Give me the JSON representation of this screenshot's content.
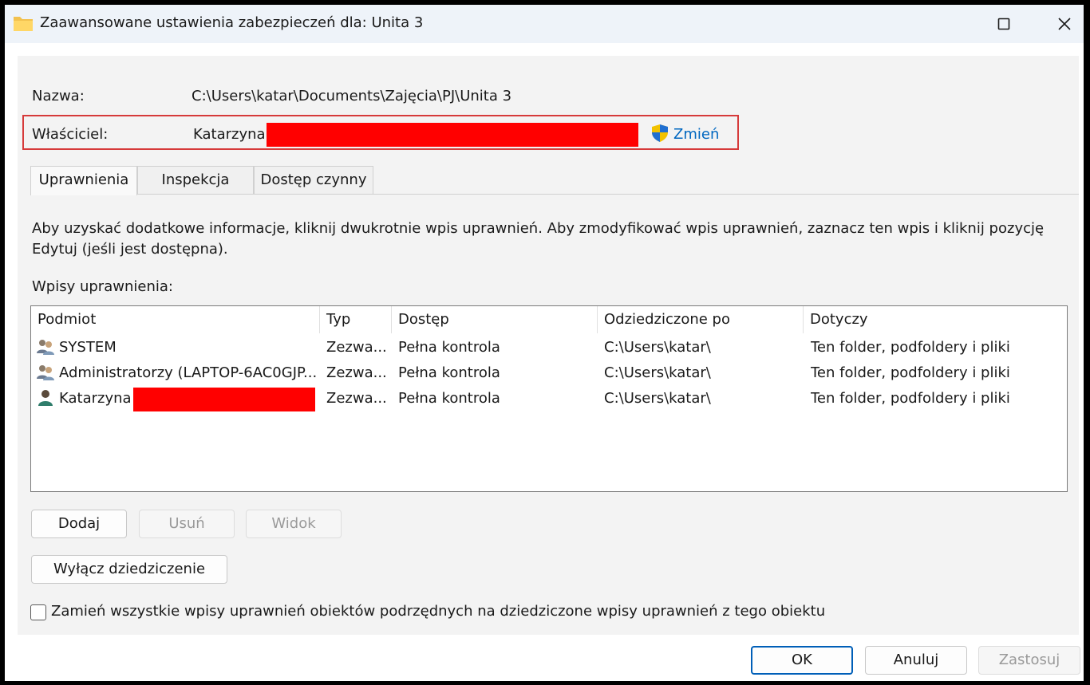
{
  "window": {
    "title": "Zaawansowane ustawienia zabezpieczeń dla: Unita 3",
    "maximize_glyph": "☐",
    "close_glyph": "✕"
  },
  "name": {
    "label": "Nazwa:",
    "value": "C:\\Users\\katar\\Documents\\Zajęcia\\PJ\\Unita 3"
  },
  "owner": {
    "label": "Właściciel:",
    "value": "Katarzyna",
    "change_label": "Zmień"
  },
  "tabs": [
    {
      "label": "Uprawnienia"
    },
    {
      "label": "Inspekcja"
    },
    {
      "label": "Dostęp czynny"
    }
  ],
  "info_text_line1": "Aby uzyskać dodatkowe informacje, kliknij dwukrotnie wpis uprawnień. Aby zmodyfikować wpis uprawnień, zaznacz ten wpis i kliknij pozycję",
  "info_text_line2": "Edytuj (jeśli jest dostępna).",
  "entries_label": "Wpisy uprawnienia:",
  "table": {
    "columns": [
      "Podmiot",
      "Typ",
      "Dostęp",
      "Odziedziczone po",
      "Dotyczy"
    ],
    "rows": [
      {
        "principal": "SYSTEM",
        "type": "Zezwa...",
        "access": "Pełna kontrola",
        "inherited": "C:\\Users\\katar\\",
        "applies": "Ten folder, podfoldery i pliki"
      },
      {
        "principal": "Administratorzy (LAPTOP-6AC0GJP...",
        "type": "Zezwa...",
        "access": "Pełna kontrola",
        "inherited": "C:\\Users\\katar\\",
        "applies": "Ten folder, podfoldery i pliki"
      },
      {
        "principal": "Katarzyna",
        "type": "Zezwa...",
        "access": "Pełna kontrola",
        "inherited": "C:\\Users\\katar\\",
        "applies": "Ten folder, podfoldery i pliki"
      }
    ]
  },
  "buttons": {
    "add": "Dodaj",
    "remove": "Usuń",
    "view": "Widok",
    "disable_inheritance": "Wyłącz dziedziczenie",
    "ok": "OK",
    "cancel": "Anuluj",
    "apply": "Zastosuj"
  },
  "replace_checkbox_label": "Zamień wszystkie wpisy uprawnień obiektów podrzędnych na dziedziczone wpisy uprawnień z tego obiektu",
  "colors": {
    "link": "#0067c0",
    "highlight_border": "#d63a3a",
    "redaction": "#ff0000",
    "accent": "#005fb8"
  }
}
